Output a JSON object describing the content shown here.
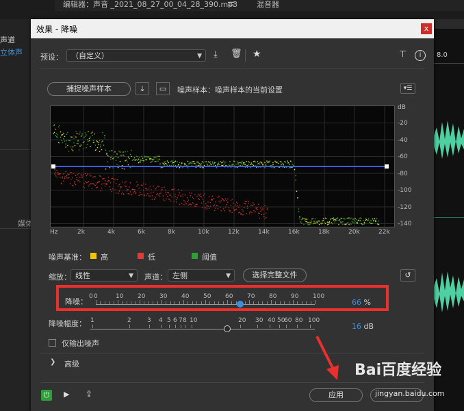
{
  "background": {
    "editor_tab": "编辑器：声音 _2021_08_27_00_04_28_390.mp3",
    "mixer_tab": "混音器",
    "left_rows": [
      "声道",
      "立体声",
      "媒体"
    ],
    "timeline_label": "8.0"
  },
  "dialog": {
    "title": "效果 - 降噪",
    "close_label": "x"
  },
  "preset": {
    "label": "预设：",
    "value": "（自定义）"
  },
  "noise_print": {
    "capture_label": "捕捉噪声样本",
    "status": "噪声样本：噪声样本的当前设置"
  },
  "graph": {
    "db_label": "dB",
    "y_ticks": [
      "-20",
      "-40",
      "-60",
      "-80",
      "-100",
      "-120",
      "-140"
    ],
    "x_ticks": [
      "Hz",
      "2k",
      "4k",
      "6k",
      "8k",
      "10k",
      "12k",
      "14k",
      "16k",
      "18k",
      "20k",
      "22k"
    ]
  },
  "legend": {
    "label": "噪声基准：",
    "items": [
      {
        "label": "高",
        "color": "#f1c40f"
      },
      {
        "label": "低",
        "color": "#e53935"
      },
      {
        "label": "阈值",
        "color": "#2e9e3a"
      }
    ]
  },
  "options": {
    "scale_label": "缩放：",
    "scale_value": "线性",
    "channel_label": "声道：",
    "channel_value": "左侧",
    "select_file_label": "选择完整文件"
  },
  "noise_reduction": {
    "label": "降噪：",
    "ticks": [
      "0",
      "0",
      "10",
      "20",
      "30",
      "40",
      "50",
      "60",
      "70",
      "80",
      "90",
      "100"
    ],
    "value": 66,
    "value_text": "66",
    "unit": "%"
  },
  "reduce_by": {
    "label": "降噪幅度：",
    "ticks": [
      "1",
      "2",
      "3",
      "4",
      "5",
      "6",
      "7",
      "8",
      "10",
      "20",
      "30",
      "40",
      "50",
      "60",
      "80",
      "100"
    ],
    "value_text": "16",
    "unit": "dB"
  },
  "output_noise_only": "仅输出噪声",
  "advanced_label": "高级",
  "footer": {
    "apply_label": "应用"
  },
  "watermark": {
    "logo": "Bai百度经验",
    "url": "jingyan.baidu.com"
  },
  "colors": {
    "accent_blue": "#3b8fe0",
    "highlight_red": "#e8312e",
    "power_green": "#2e9e3a"
  }
}
